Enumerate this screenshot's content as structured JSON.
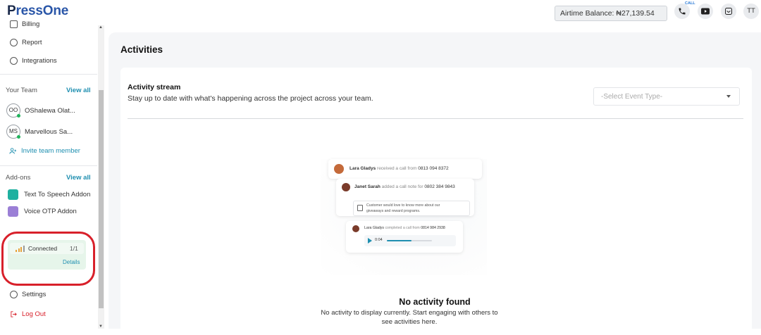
{
  "brand": {
    "logo_text": "PressOne"
  },
  "topbar": {
    "airtime_label": "Airtime Balance: ₦27,139.54",
    "call_tag": "CALL",
    "avatar_initials": "TT",
    "icons": [
      "phone-icon",
      "youtube-icon",
      "inbox-icon"
    ]
  },
  "sidebar": {
    "nav_top": [
      {
        "label": "Billing",
        "icon": "receipt-icon"
      },
      {
        "label": "Report",
        "icon": "bar-chart-icon"
      },
      {
        "label": "Integrations",
        "icon": "link-icon"
      }
    ],
    "team": {
      "title": "Your Team",
      "view_all": "View all",
      "members": [
        {
          "initials": "OO",
          "name": "OShalewa Olat..."
        },
        {
          "initials": "MS",
          "name": "Marvellous Sa..."
        }
      ],
      "invite_label": "Invite team member"
    },
    "addons": {
      "title": "Add-ons",
      "view_all": "View all",
      "items": [
        {
          "label": "Text To Speech Addon",
          "color": "#1fb0a0"
        },
        {
          "label": "Voice OTP Addon",
          "color": "#9b7fd6"
        }
      ]
    },
    "connection": {
      "status": "Connected",
      "count": "1/1",
      "details_label": "Details",
      "highlight_color": "#d8202a"
    },
    "nav_bottom": [
      {
        "label": "Settings",
        "icon": "gear-icon"
      },
      {
        "label": "Log Out",
        "icon": "logout-icon",
        "color": "#d8202a"
      }
    ]
  },
  "main": {
    "page_title": "Activities",
    "stream": {
      "title": "Activity stream",
      "subtitle": "Stay up to date with what's happening across the project across your team.",
      "select_placeholder": "-Select Event Type-"
    },
    "illustration": {
      "card1": {
        "name": "Lara Gladys",
        "action": "received a call from",
        "number": "0813 094 8372"
      },
      "card2": {
        "name": "Janet Sarah",
        "action": "added a call note for",
        "number": "0802 384 9843",
        "note_line1": "Customer would love to know more about our",
        "note_line2": "giveaways and reward programs."
      },
      "card3": {
        "name": "Lara Gladys",
        "action": "completed a call from",
        "number": "0814 984 2938",
        "audio_time": "0:04",
        "audio_progress": 0.55
      }
    },
    "empty_state": {
      "title": "No activity found",
      "message": "No activity to display currently. Start engaging with others to see activities here."
    }
  }
}
